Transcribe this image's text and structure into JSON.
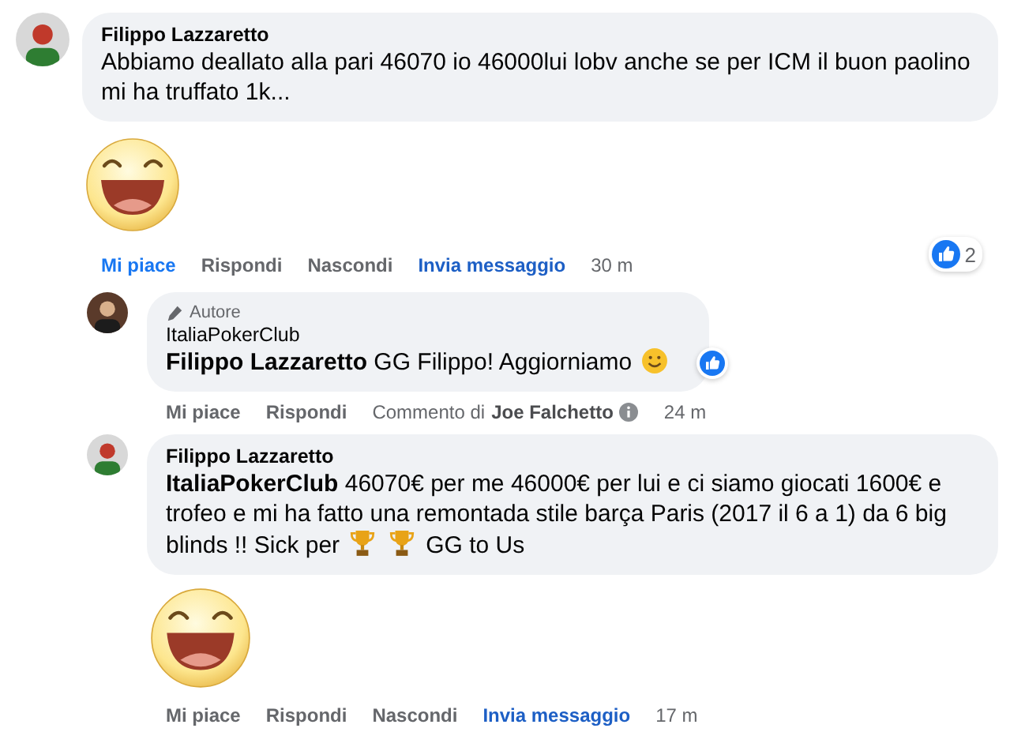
{
  "comments": [
    {
      "author": "Filippo Lazzaretto",
      "body": [
        {
          "kind": "text",
          "text": "Abbiamo deallato alla pari 46070 io 46000lui lobv anche se per ICM il buon paolino mi ha truffato 1k..."
        }
      ],
      "sticker": true,
      "liked": true,
      "actions": [
        {
          "kind": "like",
          "label": "Mi piace"
        },
        {
          "kind": "reply",
          "label": "Rispondi"
        },
        {
          "kind": "hide",
          "label": "Nascondi"
        },
        {
          "kind": "message",
          "label": "Invia messaggio"
        }
      ],
      "time": "30 m",
      "reactions": {
        "count": "2"
      },
      "replies": [
        {
          "author": "ItaliaPokerClub",
          "badge": "Autore",
          "body": [
            {
              "kind": "text",
              "text": "**Filippo Lazzaretto** GG Filippo! Aggiorniamo"
            },
            {
              "kind": "smiley"
            }
          ],
          "liked": false,
          "reacted": true,
          "actions": [
            {
              "kind": "like",
              "label": "Mi piace"
            },
            {
              "kind": "reply",
              "label": "Rispondi"
            }
          ],
          "note": {
            "prefix": "Commento di",
            "name": "Joe Falchetto"
          },
          "time": "24 m"
        },
        {
          "author": "Filippo Lazzaretto",
          "body": [
            {
              "kind": "text",
              "text": "**ItaliaPokerClub** 46070€ per me 46000€ per lui e ci siamo giocati 1600€ e trofeo e mi ha fatto una remontada stile barça Paris (2017 il 6 a 1) da 6 big"
            },
            {
              "kind": "text",
              "text": "blinds !! Sick per"
            },
            {
              "kind": "trophy"
            },
            {
              "kind": "trophy"
            },
            {
              "kind": "text",
              "text": "GG to Us"
            }
          ],
          "sticker": true,
          "liked": false,
          "actions": [
            {
              "kind": "like",
              "label": "Mi piace"
            },
            {
              "kind": "reply",
              "label": "Rispondi"
            },
            {
              "kind": "hide",
              "label": "Nascondi"
            },
            {
              "kind": "message",
              "label": "Invia messaggio"
            }
          ],
          "time": "17 m"
        }
      ]
    }
  ]
}
